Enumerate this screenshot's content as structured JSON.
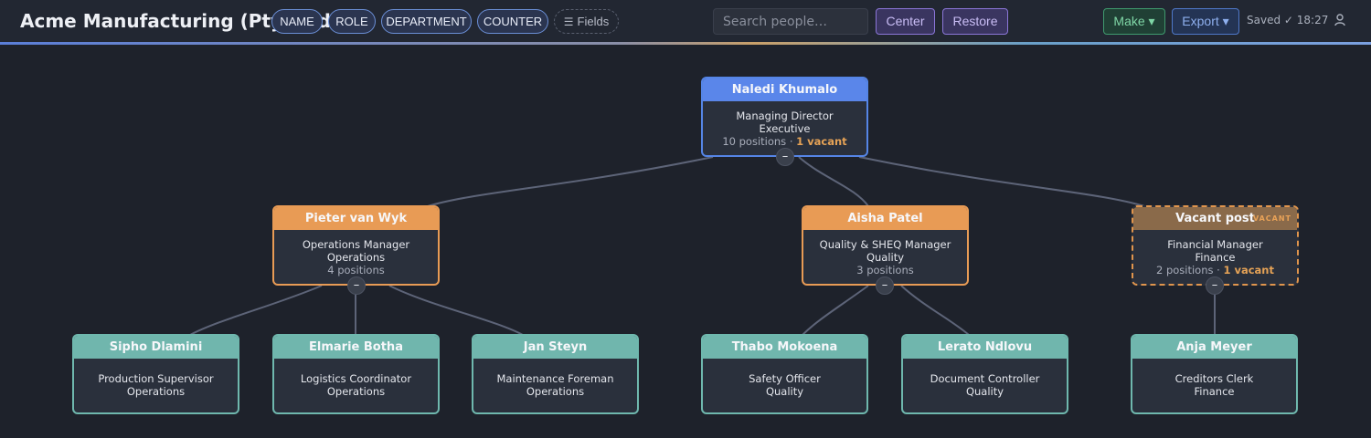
{
  "header": {
    "title": "Acme Manufacturing (Pty) Ltd",
    "fields": [
      "NAME",
      "ROLE",
      "DEPARTMENT",
      "COUNTER"
    ],
    "fields_button": "Fields",
    "search_placeholder": "Search people…",
    "center_label": "Center",
    "restore_label": "Restore",
    "make_label": "Make ▾",
    "export_label": "Export ▾",
    "saved_status": "Saved ✓ 18:27"
  },
  "icons": {
    "fields": "list-icon",
    "user": "user-icon",
    "collapse": "minus"
  },
  "colors": {
    "executive": "#5a86ea",
    "manager": "#e89b55",
    "vacant": "#8a6a4a",
    "staff": "#70b6ad",
    "vacant_text": "#e5a256"
  },
  "org": {
    "md": {
      "name": "Naledi Khumalo",
      "title": "Managing Director",
      "dept": "Executive",
      "positions": "10 positions",
      "separator": " · ",
      "vacant": "1 vacant",
      "toggle": "–"
    },
    "ops_manager": {
      "name": "Pieter van Wyk",
      "title": "Operations Manager",
      "dept": "Operations",
      "positions": "4 positions",
      "toggle": "–"
    },
    "quality_manager": {
      "name": "Aisha Patel",
      "title": "Quality & SHEQ Manager",
      "dept": "Quality",
      "positions": "3 positions",
      "toggle": "–"
    },
    "finance_vacant": {
      "name": "Vacant post",
      "tag": "VACANT",
      "title": "Financial Manager",
      "dept": "Finance",
      "positions": "2 positions",
      "separator": " · ",
      "vacant": "1 vacant",
      "toggle": "–"
    },
    "staff": [
      {
        "name": "Sipho Dlamini",
        "title": "Production Supervisor",
        "dept": "Operations"
      },
      {
        "name": "Elmarie Botha",
        "title": "Logistics Coordinator",
        "dept": "Operations"
      },
      {
        "name": "Jan Steyn",
        "title": "Maintenance Foreman",
        "dept": "Operations"
      },
      {
        "name": "Thabo Mokoena",
        "title": "Safety Officer",
        "dept": "Quality"
      },
      {
        "name": "Lerato Ndlovu",
        "title": "Document Controller",
        "dept": "Quality"
      },
      {
        "name": "Anja Meyer",
        "title": "Creditors Clerk",
        "dept": "Finance"
      }
    ]
  }
}
